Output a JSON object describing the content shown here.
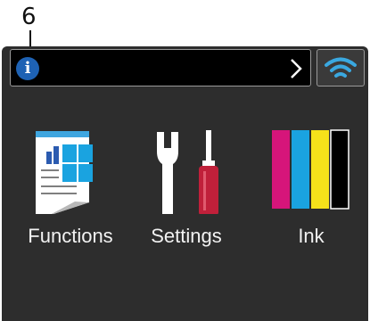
{
  "callout": {
    "number": "6"
  },
  "status_bar": {
    "text": ""
  },
  "icons": {
    "info": "info-icon",
    "chevron": "chevron-right-icon",
    "wifi": "wifi-icon"
  },
  "menu": {
    "functions": {
      "label": "Functions",
      "icon": "functions-icon"
    },
    "settings": {
      "label": "Settings",
      "icon": "settings-icon"
    },
    "ink": {
      "label": "Ink",
      "icon": "ink-icon"
    }
  },
  "colors": {
    "info_blue": "#1e62b4",
    "wifi_blue": "#3aa8e0",
    "cyan": "#1aa3e0",
    "magenta": "#d6157a",
    "yellow": "#f6e21a",
    "black": "#000000",
    "wrench": "#ffffff",
    "screwdriver_handle": "#c0203a"
  }
}
